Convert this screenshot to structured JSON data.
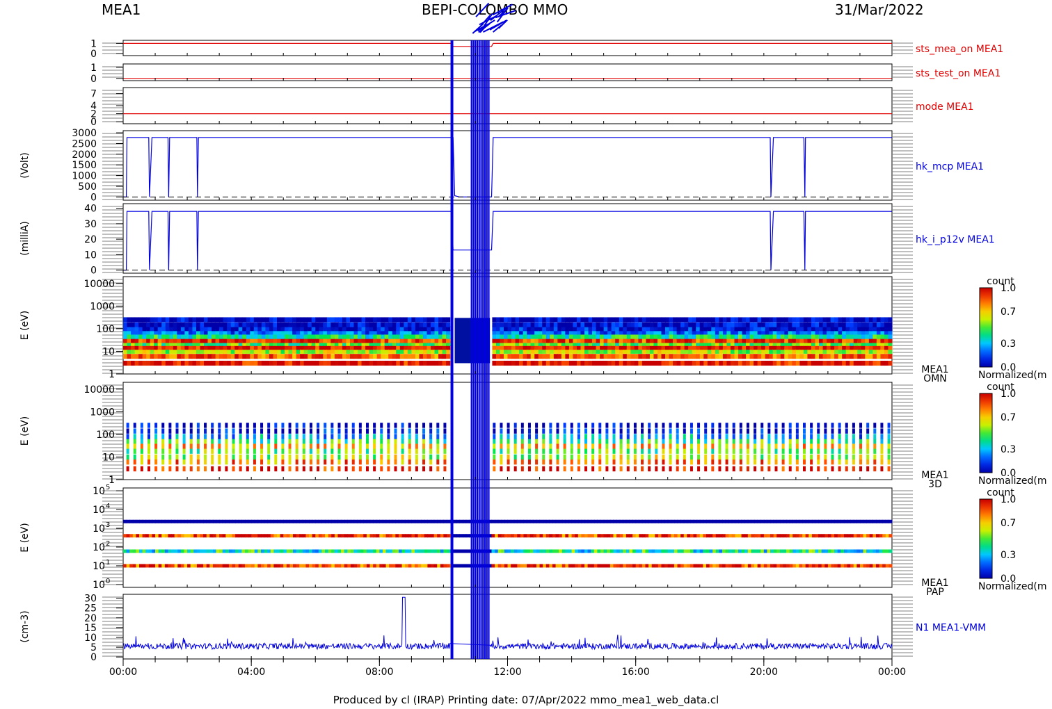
{
  "header": {
    "instrument": "MEA1",
    "mission": "BEPI-COLOMBO MMO",
    "date": "31/Mar/2022"
  },
  "footer": {
    "text": "Produced by cl (IRAP)    Printing date: 07/Apr/2022    mmo_mea1_web_data.cl"
  },
  "colors": {
    "red_trace": "#e00000",
    "blue_trace": "#0000e0",
    "axis": "#000000"
  },
  "chart_data": [
    {
      "type": "line",
      "name": "sts_mea_on",
      "label": "sts_mea_on MEA1",
      "label_color": "#e00000",
      "ylim": [
        -0.2,
        1.3
      ],
      "yticks": [
        "0",
        "1"
      ],
      "x_hours": [
        0,
        10.25,
        10.3,
        11.5,
        11.55,
        24
      ],
      "values": [
        1,
        1,
        0.7,
        0.7,
        1,
        1
      ]
    },
    {
      "type": "line",
      "name": "sts_test_on",
      "label": "sts_test_on MEA1",
      "label_color": "#e00000",
      "ylim": [
        -0.2,
        1.3
      ],
      "yticks": [
        "0",
        "1"
      ],
      "x_hours": [
        0,
        24
      ],
      "values": [
        0,
        0
      ]
    },
    {
      "type": "line",
      "name": "mode",
      "label": "mode MEA1",
      "label_color": "#e00000",
      "ylim": [
        -0.5,
        8.5
      ],
      "yticks": [
        "0",
        "2",
        "4",
        "7"
      ],
      "x_hours": [
        0,
        24
      ],
      "values": [
        2,
        2
      ]
    },
    {
      "type": "line",
      "name": "hk_mcp",
      "label": "hk_mcp MEA1",
      "ylabel": "(Volt)",
      "ylim": [
        -150,
        3100
      ],
      "yticks": [
        "0",
        "500",
        "1000",
        "1500",
        "2000",
        "2500",
        "3000"
      ],
      "x_hours": [
        0,
        0.1,
        0.12,
        0.8,
        0.82,
        0.9,
        1.4,
        1.42,
        1.45,
        2.3,
        2.32,
        2.35,
        10.3,
        10.35,
        10.5,
        11.5,
        11.55,
        20.2,
        20.22,
        20.3,
        21.25,
        21.28,
        21.3,
        24
      ],
      "values": [
        0,
        0,
        2780,
        2780,
        0,
        2780,
        2780,
        0,
        2780,
        2780,
        0,
        2780,
        2780,
        60,
        0,
        0,
        2780,
        2780,
        0,
        2780,
        2780,
        0,
        2780,
        2780
      ]
    },
    {
      "type": "line",
      "name": "hk_i_p12v",
      "label": "hk_i_p12v MEA1",
      "ylabel": "(milliA)",
      "ylim": [
        -2,
        43
      ],
      "yticks": [
        "0",
        "10",
        "20",
        "30",
        "40"
      ],
      "x_hours": [
        0,
        0.1,
        0.12,
        0.8,
        0.82,
        0.9,
        1.4,
        1.42,
        1.45,
        2.3,
        2.32,
        2.35,
        10.25,
        10.3,
        10.7,
        11.5,
        11.55,
        20.2,
        20.22,
        20.3,
        21.25,
        21.28,
        21.3,
        24
      ],
      "values": [
        0,
        0,
        38,
        38,
        0,
        38,
        38,
        0,
        38,
        38,
        0,
        38,
        38,
        13,
        13,
        13,
        38,
        38,
        0,
        38,
        38,
        0,
        38,
        38
      ]
    },
    {
      "type": "heatmap",
      "name": "omni",
      "ylabel": "E (eV)",
      "yticks": [
        "1",
        "10",
        "100",
        "1000",
        "10000"
      ],
      "side_label": [
        "MEA1",
        "OMN"
      ],
      "colorbar": {
        "title": "count",
        "ticks": [
          "0.0",
          "0.3",
          "0.7",
          "1.0"
        ],
        "caption": "Normalized(m"
      },
      "energy_rows": [
        3,
        6,
        10,
        15,
        22,
        30,
        45,
        70,
        100,
        150,
        250
      ],
      "row_levels": [
        0.95,
        0.85,
        0.6,
        0.95,
        0.5,
        0.9,
        0.4,
        0.2,
        0.08,
        0.03,
        0.02
      ]
    },
    {
      "type": "heatmap",
      "name": "3d",
      "ylabel": "E (eV)",
      "yticks": [
        "1",
        "10",
        "100",
        "1000",
        "10000"
      ],
      "side_label": [
        "MEA1",
        "3D"
      ],
      "colorbar": {
        "title": "count",
        "ticks": [
          "0.0",
          "0.3",
          "0.7",
          "1.0"
        ],
        "caption": "Normalized(m"
      },
      "energy_rows": [
        3,
        6,
        10,
        18,
        30,
        50,
        80,
        140,
        250
      ],
      "row_levels": [
        0.95,
        0.8,
        0.6,
        0.5,
        0.7,
        0.45,
        0.25,
        0.05,
        0.0
      ]
    },
    {
      "type": "heatmap",
      "name": "pap",
      "ylabel": "E (eV)",
      "yticks": [
        "10^0",
        "10^1",
        "10^2",
        "10^3",
        "10^4",
        "10^5"
      ],
      "side_label": [
        "MEA1",
        "PAP"
      ],
      "colorbar": {
        "title": "count",
        "ticks": [
          "0.0",
          "0.3",
          "0.7",
          "1.0"
        ],
        "caption": "Normalized(m"
      },
      "energy_rows": [
        10,
        60,
        400,
        2300
      ],
      "row_levels": [
        0.9,
        0.4,
        0.9,
        0.0
      ]
    },
    {
      "type": "line",
      "name": "density",
      "label": "N1 MEA1-VMM",
      "ylabel": "(cm-3)",
      "ylim": [
        -1,
        32
      ],
      "yticks": [
        "0",
        "5",
        "10",
        "15",
        "20",
        "25",
        "30"
      ],
      "baseline": 5.5,
      "spike_hour": 8.75,
      "spike_value": 30.5
    }
  ],
  "x_axis": {
    "ticks": [
      "00:00",
      "04:00",
      "08:00",
      "12:00",
      "16:00",
      "20:00",
      "00:00"
    ],
    "range_hours": [
      0,
      24
    ]
  },
  "gap": {
    "start_hours": 10.2,
    "end_hours": 11.45
  }
}
